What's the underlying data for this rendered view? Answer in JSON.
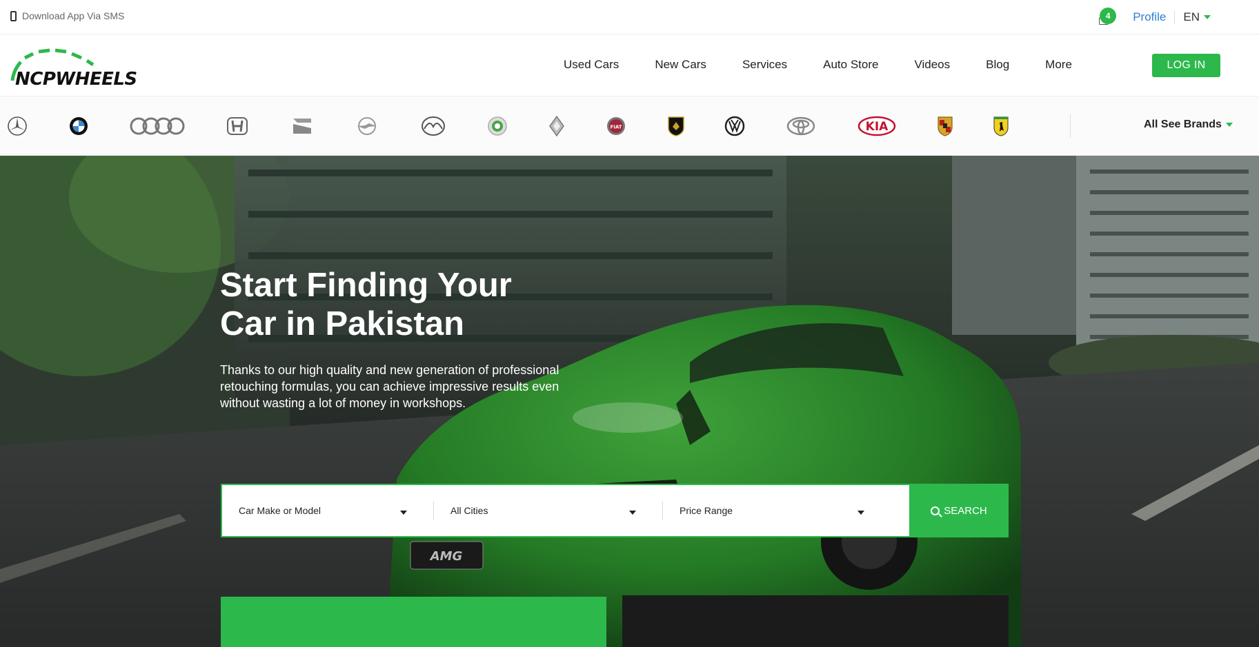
{
  "topbar": {
    "sms_text": "Download App Via SMS",
    "cart_count": "4",
    "profile_label": "Profile",
    "language": "EN"
  },
  "logo": {
    "text": "NCPWHEELS"
  },
  "nav": {
    "items": [
      "Used Cars",
      "New Cars",
      "Services",
      "Auto Store",
      "Videos",
      "Blog",
      "More"
    ],
    "login_label": "LOG IN"
  },
  "brands": {
    "logos": [
      "mercedes-benz",
      "bmw",
      "audi",
      "honda",
      "seat",
      "opel",
      "mazda",
      "skoda",
      "renault",
      "fiat",
      "lamborghini",
      "volkswagen",
      "toyota",
      "kia",
      "porsche",
      "ferrari"
    ],
    "kia_text": "KIA",
    "all_brands_label": "All See Brands"
  },
  "hero": {
    "title_line1": "Start Finding Your",
    "title_line2": "Car in Pakistan",
    "subtitle": "Thanks to our high quality and new generation of professional retouching formulas, you can achieve impressive results even without wasting a lot of money in workshops."
  },
  "search": {
    "make_model": "Car Make or Model",
    "cities": "All Cities",
    "price_range": "Price Range",
    "button_label": "SEARCH"
  },
  "colors": {
    "accent": "#2db84c",
    "link": "#2d7fd3",
    "car_green": "#2f8a2c"
  }
}
